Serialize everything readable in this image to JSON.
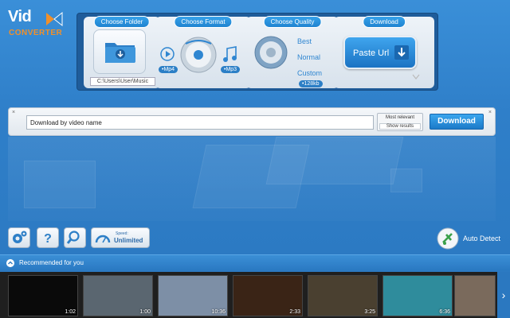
{
  "app": {
    "logo_main": "Vid",
    "logo_sub": "CONVERTER"
  },
  "top_panel": {
    "choose_folder": {
      "title": "Choose Folder",
      "path": "C:\\Users\\User\\Music"
    },
    "choose_format": {
      "title": "Choose Format",
      "left_format": "•Mp4",
      "right_format": "•Mp3"
    },
    "choose_quality": {
      "title": "Choose Quality",
      "options": [
        "Best",
        "Normal",
        "Custom"
      ],
      "custom_value": "•128kb"
    },
    "download": {
      "title": "Download",
      "paste_label": "Paste Url"
    }
  },
  "search": {
    "value": "Download by video name",
    "sort_label": "Most relevant",
    "show_results": "Show results",
    "download_label": "Download",
    "close_glyph": "×"
  },
  "toolbar": {
    "speed_label": "Speed:",
    "speed_value": "Unlimited",
    "auto_detect": "Auto Detect"
  },
  "recommended": {
    "title": "Recommended for you",
    "videos": [
      {
        "duration": "1:02",
        "color": "#0a0a0a"
      },
      {
        "duration": "1:00",
        "color": "#5a6670"
      },
      {
        "duration": "10:36",
        "color": "#7d8fa6"
      },
      {
        "duration": "2:33",
        "color": "#3a2416"
      },
      {
        "duration": "3:25",
        "color": "#4a4030"
      },
      {
        "duration": "6:36",
        "color": "#2f8c9c"
      },
      {
        "duration": "",
        "color": "#7a6a5c"
      }
    ],
    "next_glyph": "›"
  },
  "colors": {
    "accent": "#2c86d1",
    "background": "#2f7fc9",
    "logo_orange": "#f0902a"
  }
}
